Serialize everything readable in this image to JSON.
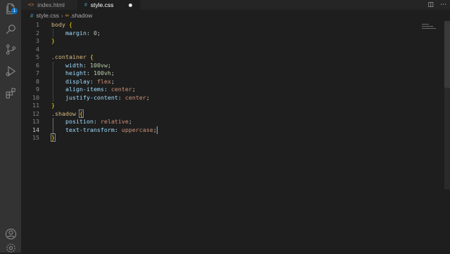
{
  "tabs": [
    {
      "label": "index.html",
      "icon": "<>",
      "active": false
    },
    {
      "label": "style.css",
      "icon": "#",
      "active": true,
      "unsaved": true
    }
  ],
  "breadcrumb": {
    "file": "style.css",
    "symbol": ".shadow"
  },
  "activity_bar": {
    "badge_count": "1",
    "icons": [
      "explorer-icon",
      "search-icon",
      "source-control-icon",
      "run-debug-icon",
      "extensions-icon",
      "account-icon",
      "settings-gear-icon"
    ]
  },
  "editor": {
    "language": "css",
    "current_line": 14,
    "lines": [
      {
        "n": "1",
        "tokens": [
          {
            "t": "body",
            "c": "sel"
          },
          {
            "t": " ",
            "c": "punc"
          },
          {
            "t": "{",
            "c": "brace"
          }
        ]
      },
      {
        "n": "2",
        "tokens": [
          {
            "t": "    margin",
            "c": "prop"
          },
          {
            "t": ": ",
            "c": "punc"
          },
          {
            "t": "0",
            "c": "num"
          },
          {
            "t": ";",
            "c": "punc"
          }
        ]
      },
      {
        "n": "3",
        "tokens": [
          {
            "t": "}",
            "c": "brace"
          }
        ]
      },
      {
        "n": "4",
        "tokens": []
      },
      {
        "n": "5",
        "tokens": [
          {
            "t": ".container",
            "c": "sel"
          },
          {
            "t": " ",
            "c": "punc"
          },
          {
            "t": "{",
            "c": "brace"
          }
        ]
      },
      {
        "n": "6",
        "tokens": [
          {
            "t": "    width",
            "c": "prop"
          },
          {
            "t": ": ",
            "c": "punc"
          },
          {
            "t": "100vw",
            "c": "num"
          },
          {
            "t": ";",
            "c": "punc"
          }
        ]
      },
      {
        "n": "7",
        "tokens": [
          {
            "t": "    height",
            "c": "prop"
          },
          {
            "t": ": ",
            "c": "punc"
          },
          {
            "t": "100vh",
            "c": "num"
          },
          {
            "t": ";",
            "c": "punc"
          }
        ]
      },
      {
        "n": "8",
        "tokens": [
          {
            "t": "    display",
            "c": "prop"
          },
          {
            "t": ": ",
            "c": "punc"
          },
          {
            "t": "flex",
            "c": "val"
          },
          {
            "t": ";",
            "c": "punc"
          }
        ]
      },
      {
        "n": "9",
        "tokens": [
          {
            "t": "    align-items",
            "c": "prop"
          },
          {
            "t": ": ",
            "c": "punc"
          },
          {
            "t": "center",
            "c": "val"
          },
          {
            "t": ";",
            "c": "punc"
          }
        ]
      },
      {
        "n": "10",
        "tokens": [
          {
            "t": "    justify-content",
            "c": "prop"
          },
          {
            "t": ": ",
            "c": "punc"
          },
          {
            "t": "center",
            "c": "val"
          },
          {
            "t": ";",
            "c": "punc"
          }
        ]
      },
      {
        "n": "11",
        "tokens": [
          {
            "t": "}",
            "c": "brace"
          }
        ]
      },
      {
        "n": "12",
        "tokens": [
          {
            "t": ".shadow",
            "c": "sel"
          },
          {
            "t": " ",
            "c": "punc"
          },
          {
            "t": "{",
            "c": "brace brace-box"
          }
        ]
      },
      {
        "n": "13",
        "tokens": [
          {
            "t": "    position",
            "c": "prop"
          },
          {
            "t": ": ",
            "c": "punc"
          },
          {
            "t": "relative",
            "c": "val"
          },
          {
            "t": ";",
            "c": "punc"
          }
        ]
      },
      {
        "n": "14",
        "tokens": [
          {
            "t": "    text-transform",
            "c": "prop"
          },
          {
            "t": ": ",
            "c": "punc"
          },
          {
            "t": "uppercase",
            "c": "val"
          },
          {
            "t": ";",
            "c": "punc"
          }
        ]
      },
      {
        "n": "15",
        "tokens": [
          {
            "t": "}",
            "c": "brace brace-box"
          }
        ]
      }
    ]
  }
}
